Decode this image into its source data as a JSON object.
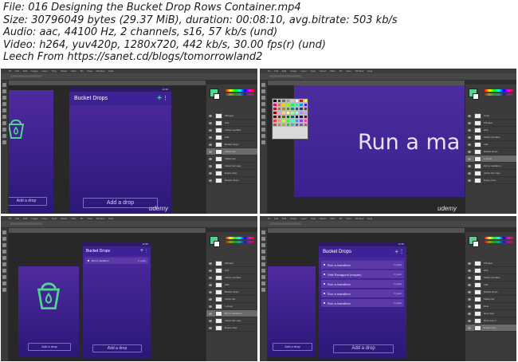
{
  "file_info": {
    "file": "File: 016 Designing the Bucket Drop Rows Container.mp4",
    "size": "Size: 30796049 bytes (29.37 MiB), duration: 00:08:10, avg.bitrate: 503 kb/s",
    "audio": "Audio: aac, 44100 Hz, 2 channels, s16, 57 kb/s (und)",
    "video": "Video: h264, yuv420p, 1280x720, 442 kb/s, 30.00 fps(r) (und)",
    "leech": "Leech From https://sanet.cd/blogs/tomorrowland2"
  },
  "photoshop": {
    "menu": [
      "Ps",
      "File",
      "Edit",
      "Image",
      "Layer",
      "Type",
      "Select",
      "Filter",
      "3D",
      "View",
      "Window",
      "Help"
    ]
  },
  "app": {
    "title": "Bucket Drops",
    "add_label": "Add a drop",
    "time": "12:30"
  },
  "frame1": {
    "layers": [
      "Fill layer",
      "Hint",
      "Action overflow",
      "Add",
      "Bucket drops",
      "Action bar",
      "Status bar",
      "Action bar copy",
      "Empty drop",
      "Bucket drops"
    ]
  },
  "frame2": {
    "big_text": "Run a ma",
    "layers": [
      "Color",
      "Fill layer",
      "Hint",
      "Action overflow",
      "Add",
      "Bucket drops",
      "1 drops",
      "Run a marathon",
      "Action bar copy",
      "Empty drop"
    ]
  },
  "frame3": {
    "rows": [
      {
        "text": "Run a marathon",
        "date": "2 years"
      }
    ],
    "layers": [
      "Fill layer",
      "Hint",
      "Action overflow",
      "Add",
      "Bucket drops",
      "Action bar",
      "1 drops",
      "Run a marathon",
      "Action bar copy",
      "Empty drop"
    ]
  },
  "frame4": {
    "rows": [
      {
        "text": "Run a marathon",
        "date": "2 years"
      },
      {
        "text": "Visit Ravagood (mayan)",
        "date": "2 years"
      },
      {
        "text": "Run a marathon",
        "date": "2 years"
      },
      {
        "text": "Run a marathon",
        "date": "2 years"
      },
      {
        "text": "Run a marathon",
        "date": "2 years"
      }
    ],
    "layers": [
      "Fill layer",
      "Hint",
      "Action overflow",
      "Add",
      "Bucket drops",
      "Status bar",
      "Row",
      "Row copy",
      "Row copy 2",
      "Empty drop"
    ]
  },
  "watermark": "udemy",
  "colors": {
    "accent_green": "#4dd68d",
    "app_purple": "#3d2296",
    "bg_purple_top": "#4f2aa0",
    "bg_purple_bottom": "#2b1878",
    "row_purple": "#5b3aa8",
    "ps_background": "#535353"
  }
}
